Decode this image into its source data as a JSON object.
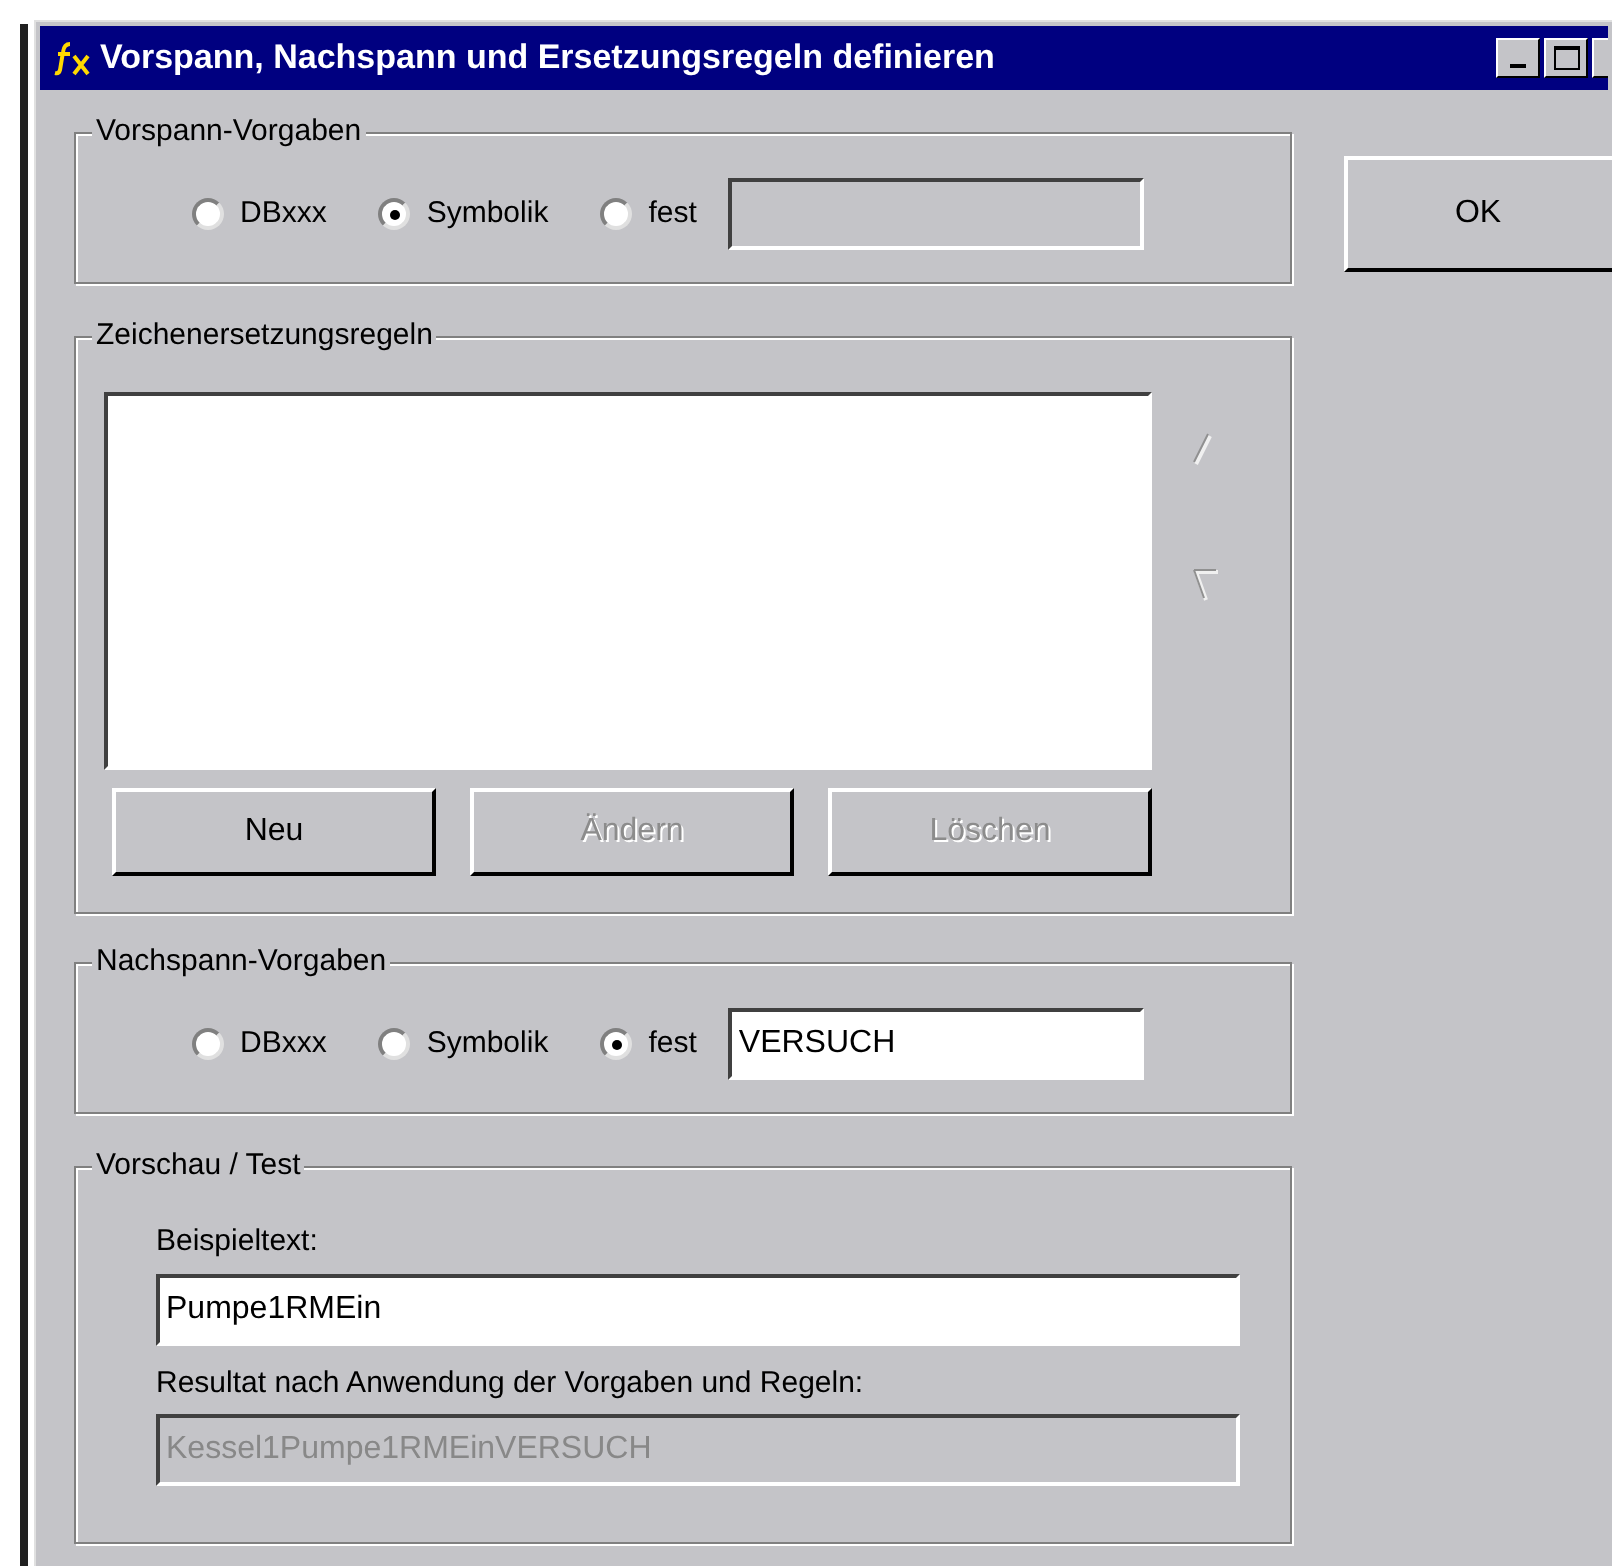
{
  "window": {
    "title": "Vorspann, Nachspann und Ersetzungsregeln definieren"
  },
  "vorspann": {
    "title": "Vorspann-Vorgaben",
    "options": [
      {
        "label": "DBxxx",
        "selected": false
      },
      {
        "label": "Symbolik",
        "selected": true
      },
      {
        "label": "fest",
        "selected": false
      }
    ],
    "field": {
      "disabled": true
    }
  },
  "ok_button": "OK",
  "rules": {
    "title": "Zeichenersetzungsregeln",
    "buttons": [
      {
        "label": "Neu",
        "disabled": false
      },
      {
        "label": "Ändern",
        "disabled": true
      },
      {
        "label": "Löschen",
        "disabled": true
      }
    ]
  },
  "nachspann": {
    "title": "Nachspann-Vorgaben",
    "options": [
      {
        "label": "DBxxx",
        "selected": false
      },
      {
        "label": "Symbolik",
        "selected": false
      },
      {
        "label": "fest",
        "selected": true
      }
    ],
    "field": {
      "value": "VERSUCH",
      "disabled": false
    }
  },
  "preview": {
    "title": "Vorschau / Test",
    "example_label": "Beispieltext:",
    "example_value": "Pumpe1RMEin",
    "result_label": "Resultat nach Anwendung der Vorgaben und Regeln:",
    "result_value": "Kessel1Pumpe1RMEinVERSUCH"
  }
}
